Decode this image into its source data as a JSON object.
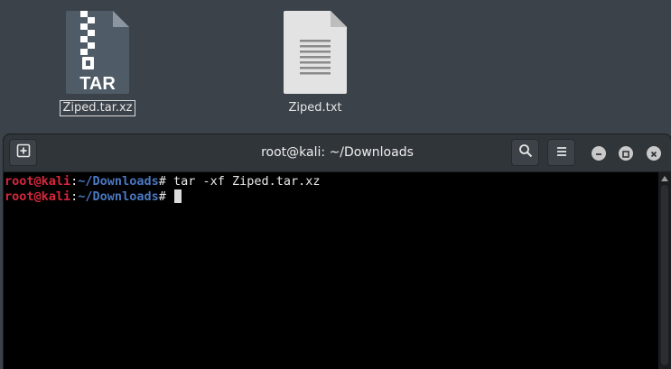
{
  "desktop": {
    "icons": [
      {
        "name": "Ziped.tar.xz",
        "badge": "TAR",
        "selected": true
      },
      {
        "name": "Ziped.txt",
        "selected": false
      }
    ]
  },
  "terminal": {
    "title": "root@kali: ~/Downloads",
    "lines": [
      {
        "user": "root@kali",
        "colon": ":",
        "path": "~/Downloads",
        "symbol": "#",
        "command": " tar -xf Ziped.tar.xz"
      },
      {
        "user": "root@kali",
        "colon": ":",
        "path": "~/Downloads",
        "symbol": "#",
        "command": " "
      }
    ],
    "colors": {
      "prompt_user": "#d7263d",
      "prompt_path": "#4a78c2",
      "background": "#000000",
      "titlebar": "#30353a"
    },
    "icons": {
      "new_tab": "new-tab-icon",
      "search": "search-icon",
      "menu": "hamburger-menu-icon",
      "minimize": "minimize-icon",
      "maximize": "maximize-icon",
      "close": "close-icon"
    }
  }
}
